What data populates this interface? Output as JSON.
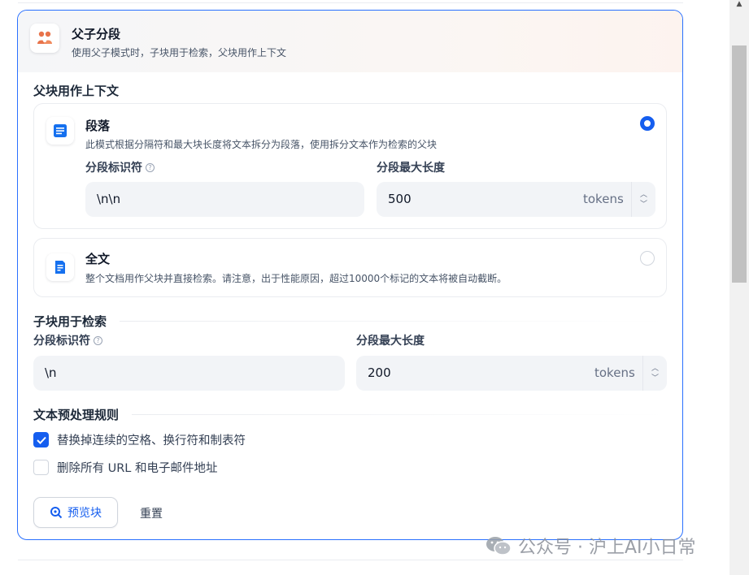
{
  "header": {
    "icon": "parent-child-icon",
    "title": "父子分段",
    "subtitle": "使用父子模式时，子块用于检索，父块用作上下文"
  },
  "parent_section": {
    "title": "父块用作上下文",
    "paragraph": {
      "icon": "paragraph-icon",
      "title": "段落",
      "description": "此模式根据分隔符和最大块长度将文本拆分为段落，使用拆分文本作为检索的父块",
      "selected": true,
      "separator_label": "分段标识符",
      "separator_value": "\\n\\n",
      "max_length_label": "分段最大长度",
      "max_length_value": "500",
      "unit": "tokens"
    },
    "full_doc": {
      "icon": "document-icon",
      "title": "全文",
      "description": "整个文档用作父块并直接检索。请注意，出于性能原因，超过10000个标记的文本将被自动截断。",
      "selected": false
    }
  },
  "child_section": {
    "title": "子块用于检索",
    "separator_label": "分段标识符",
    "separator_value": "\\n",
    "max_length_label": "分段最大长度",
    "max_length_value": "200",
    "unit": "tokens"
  },
  "rules_section": {
    "title": "文本预处理规则",
    "rules": [
      {
        "label": "替换掉连续的空格、换行符和制表符",
        "checked": true
      },
      {
        "label": "删除所有 URL 和电子邮件地址",
        "checked": false
      }
    ]
  },
  "actions": {
    "preview_label": "预览块",
    "reset_label": "重置"
  },
  "watermark": {
    "text": "公众号 · 沪上AI小日常",
    "icon": "wechat-icon"
  },
  "colors": {
    "accent": "#155eef",
    "card_border": "#2970ff",
    "input_bg": "#f2f4f7"
  }
}
